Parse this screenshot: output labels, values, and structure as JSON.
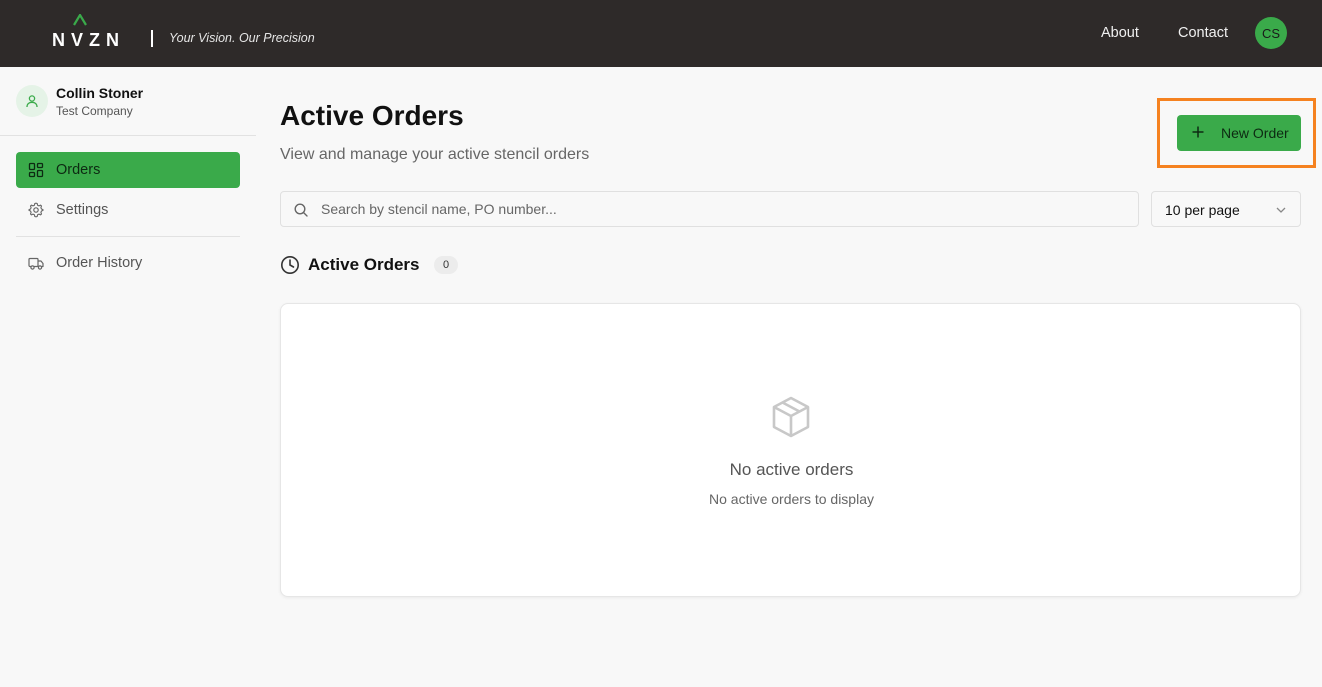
{
  "header": {
    "logo_text": "NVZN",
    "tagline": "Your Vision. Our Precision",
    "nav": {
      "about": "About",
      "contact": "Contact"
    },
    "user_initials": "CS"
  },
  "sidebar": {
    "user": {
      "name": "Collin Stoner",
      "company": "Test Company"
    },
    "items": [
      {
        "label": "Orders",
        "icon": "grid-icon",
        "active": true
      },
      {
        "label": "Settings",
        "icon": "gear-icon",
        "active": false
      },
      {
        "label": "Order History",
        "icon": "truck-icon",
        "active": false
      }
    ]
  },
  "main": {
    "title": "Active Orders",
    "subtitle": "View and manage your active stencil orders",
    "new_order_label": "New Order",
    "search": {
      "placeholder": "Search by stencil name, PO number...",
      "value": ""
    },
    "per_page": {
      "selected": "10 per page"
    },
    "section": {
      "title": "Active Orders",
      "count": "0"
    },
    "empty_state": {
      "title": "No active orders",
      "subtitle": "No active orders to display"
    }
  },
  "colors": {
    "brand_green": "#3aaa4a",
    "header_bg": "#2e2a29",
    "highlight_orange": "#f58220"
  }
}
